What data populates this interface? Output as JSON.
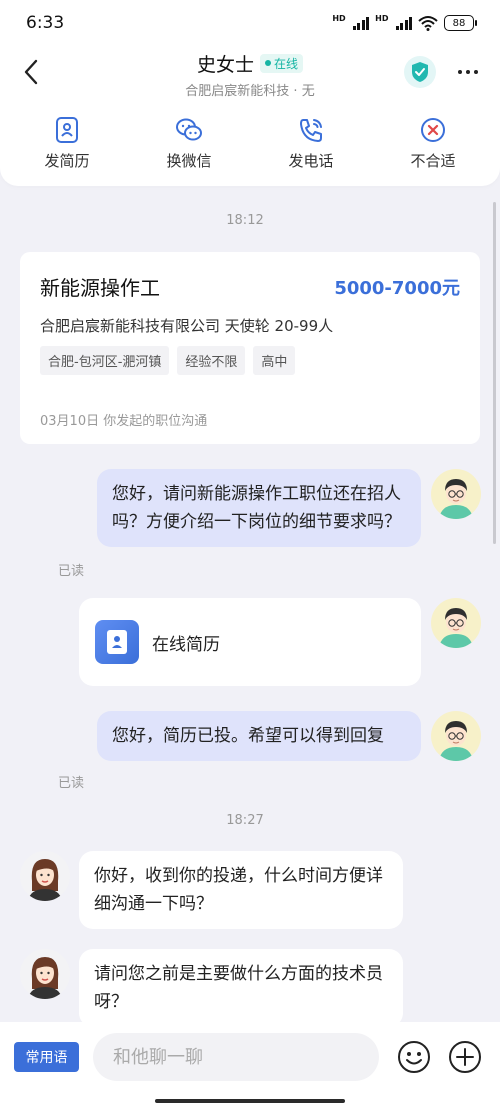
{
  "status_bar": {
    "time": "6:33",
    "battery": "88",
    "signal_label": "HD"
  },
  "header": {
    "contact_name": "史女士",
    "online_label": "在线",
    "company_line": "合肥启宸新能科技 · 无"
  },
  "actions": [
    {
      "label": "发简历",
      "icon": "resume-icon"
    },
    {
      "label": "换微信",
      "icon": "wechat-icon"
    },
    {
      "label": "发电话",
      "icon": "phone-icon"
    },
    {
      "label": "不合适",
      "icon": "not-suitable-icon"
    }
  ],
  "chat": {
    "timestamp_1": "18:12",
    "job_card": {
      "title": "新能源操作工",
      "salary": "5000-7000元",
      "company": "合肥启宸新能科技有限公司 天使轮 20-99人",
      "tags": [
        "合肥-包河区-淝河镇",
        "经验不限",
        "高中"
      ],
      "footer": "03月10日 你发起的职位沟通"
    },
    "messages": [
      {
        "from": "me",
        "text": "您好，请问新能源操作工职位还在招人吗？方便介绍一下岗位的细节要求吗？",
        "status": "已读"
      },
      {
        "from": "me",
        "type": "resume",
        "text": "在线简历"
      },
      {
        "from": "me",
        "text": "您好，简历已投。希望可以得到回复",
        "status": "已读"
      }
    ],
    "timestamp_2": "18:27",
    "replies": [
      {
        "from": "other",
        "text": "你好，收到你的投递，什么时间方便详细沟通一下吗？"
      },
      {
        "from": "other",
        "text": "请问您之前是主要做什么方面的技术员呀？"
      }
    ]
  },
  "input_bar": {
    "phrase_button": "常用语",
    "placeholder": "和他聊一聊"
  },
  "colors": {
    "accent": "#3b6fd9",
    "my_bubble": "#dfe3fb",
    "online": "#16b5a4",
    "background": "#f1f1f7"
  }
}
